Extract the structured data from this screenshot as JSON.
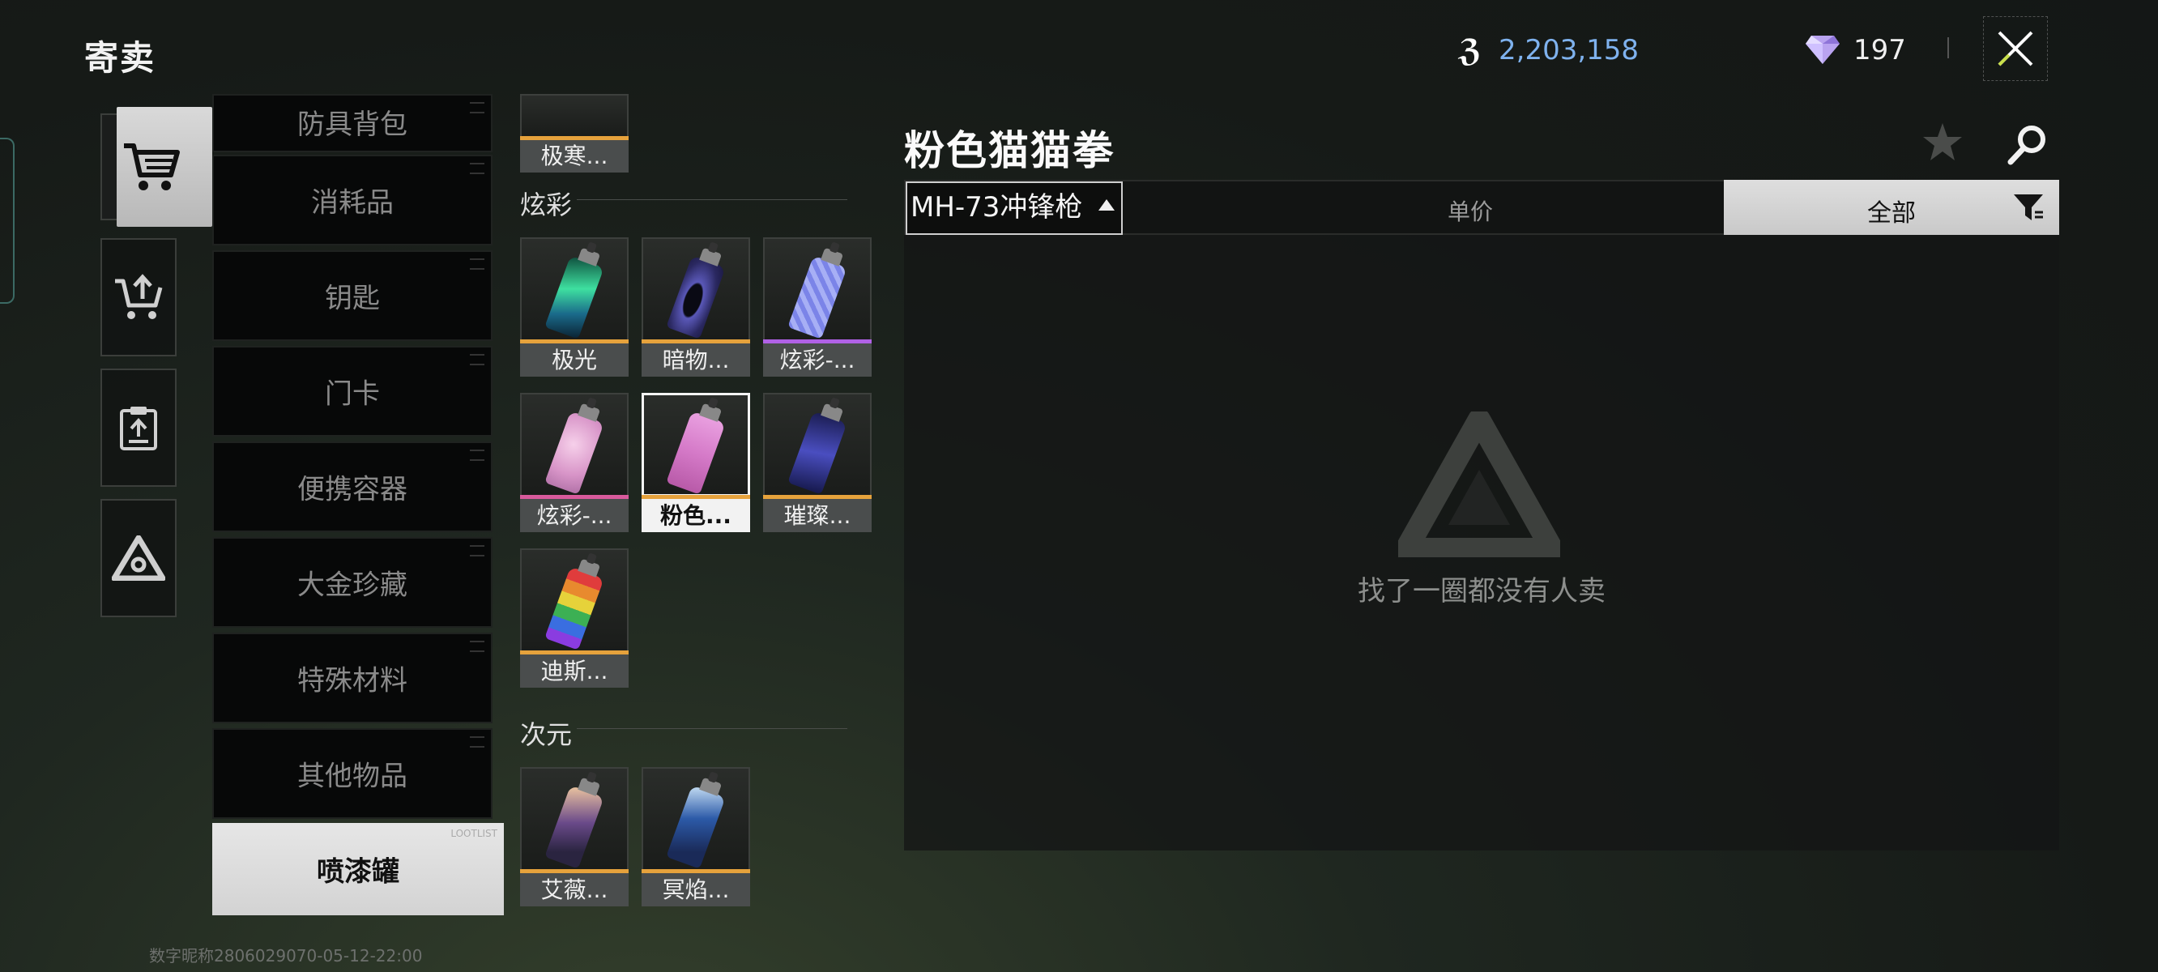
{
  "header": {
    "title": "寄卖",
    "currency_symbol": "ℨ",
    "currency_value": "2,203,158",
    "gem_value": "197"
  },
  "categories": [
    {
      "label": "防具背包",
      "state": "partial"
    },
    {
      "label": "消耗品"
    },
    {
      "label": "钥匙"
    },
    {
      "label": "门卡"
    },
    {
      "label": "便携容器"
    },
    {
      "label": "大金珍藏"
    },
    {
      "label": "特殊材料"
    },
    {
      "label": "其他物品"
    }
  ],
  "selected_category": {
    "label": "喷漆罐",
    "watermark": "LOOTLIST"
  },
  "items_top": {
    "name": "极寒..."
  },
  "sections": [
    {
      "title": "炫彩",
      "items": [
        {
          "name": "极光",
          "rarity_color": "#e6a23c",
          "can": "aurora"
        },
        {
          "name": "暗物...",
          "rarity_color": "#e6a23c",
          "can": "dark"
        },
        {
          "name": "炫彩-...",
          "rarity_color": "#b061e6",
          "can": "blue"
        },
        {
          "name": "炫彩-...",
          "rarity_color": "#d85a9c",
          "can": "pinkspray"
        },
        {
          "name": "粉色...",
          "rarity_color": "#e6a23c",
          "can": "pink",
          "selected": true
        },
        {
          "name": "璀璨...",
          "rarity_color": "#e6a23c",
          "can": "navy"
        },
        {
          "name": "迪斯...",
          "rarity_color": "#e6a23c",
          "can": "rainbow"
        }
      ]
    },
    {
      "title": "次元",
      "items": [
        {
          "name": "艾薇...",
          "rarity_color": "#e6a23c",
          "can": "anime1"
        },
        {
          "name": "冥焰...",
          "rarity_color": "#e6a23c",
          "can": "anime2"
        }
      ]
    }
  ],
  "detail": {
    "title": "粉色猫猫拳",
    "weapon_filter": "MH-73冲锋枪",
    "sort_label": "单价",
    "filter_label": "全部",
    "empty_message": "找了一圈都没有人卖"
  },
  "footer": {
    "watermark": "数字昵称2806029070-05-12-22:00"
  }
}
